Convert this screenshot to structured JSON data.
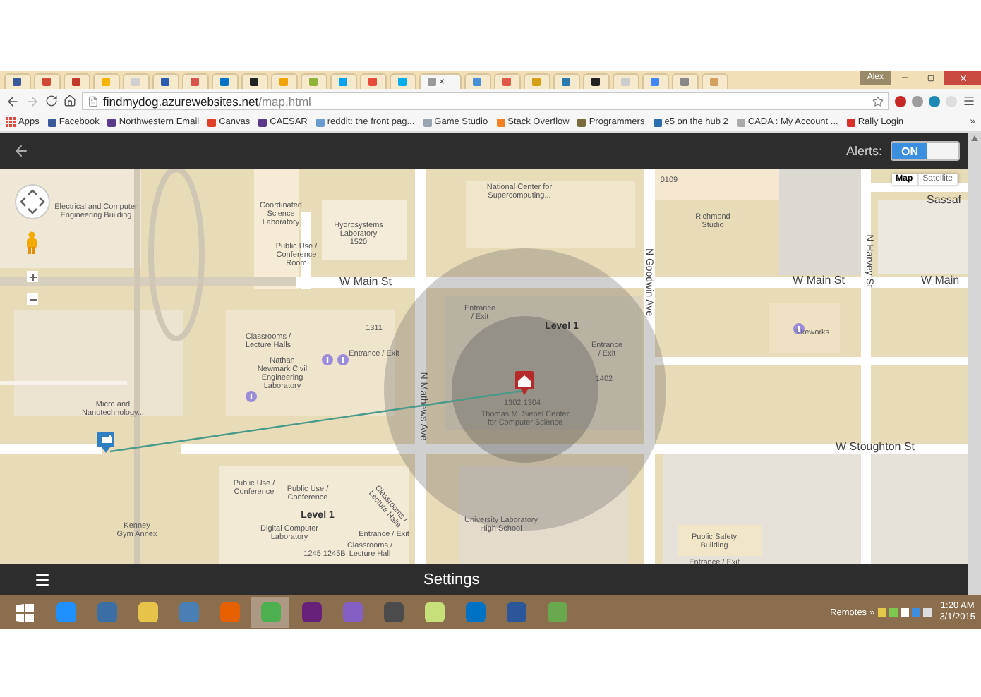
{
  "browser": {
    "tabs": [
      {
        "color": "#3b5998",
        "selected": false
      },
      {
        "color": "#d14836",
        "selected": false
      },
      {
        "color": "#c0392b",
        "selected": false
      },
      {
        "color": "#f4b400",
        "selected": false
      },
      {
        "color": "#cfcfcf",
        "selected": false
      },
      {
        "color": "#2a5db0",
        "selected": false
      },
      {
        "color": "#d9534f",
        "selected": false
      },
      {
        "color": "#0072c6",
        "selected": false
      },
      {
        "color": "#222222",
        "selected": false
      },
      {
        "color": "#f0a30a",
        "selected": false
      },
      {
        "color": "#8fb339",
        "selected": false
      },
      {
        "color": "#00a1f1",
        "selected": false
      },
      {
        "color": "#e74c3c",
        "selected": false
      },
      {
        "color": "#00adef",
        "selected": false
      },
      {
        "color": "#999999",
        "selected": true
      },
      {
        "color": "#4a90d9",
        "selected": false
      },
      {
        "color": "#e05a47",
        "selected": false
      },
      {
        "color": "#d4a017",
        "selected": false
      },
      {
        "color": "#2a7ab0",
        "selected": false
      },
      {
        "color": "#222222",
        "selected": false
      },
      {
        "color": "#cccccc",
        "selected": false
      },
      {
        "color": "#4285f4",
        "selected": false
      },
      {
        "color": "#888888",
        "selected": false
      },
      {
        "color": "#d4a060",
        "selected": false
      }
    ],
    "tab_close": "×",
    "profile": "Alex",
    "address": {
      "domain": "findmydog.azurewebsites.net",
      "path": "/map.html"
    },
    "bookmarks": [
      {
        "label": "Apps",
        "color": "#e04a3a"
      },
      {
        "label": "Facebook",
        "color": "#3b5998"
      },
      {
        "label": "Northwestern Email",
        "color": "#5b3a8c"
      },
      {
        "label": "Canvas",
        "color": "#e13f2b"
      },
      {
        "label": "CAESAR",
        "color": "#5b3a8c"
      },
      {
        "label": "reddit: the front pag...",
        "color": "#6b9bd1"
      },
      {
        "label": "Game Studio",
        "color": "#9aa3b0"
      },
      {
        "label": "Stack Overflow",
        "color": "#f48024"
      },
      {
        "label": "Programmers",
        "color": "#7a6a3a"
      },
      {
        "label": "e5 on the hub 2",
        "color": "#2a6db0"
      },
      {
        "label": "CADA : My Account ...",
        "color": "#aaaaaa"
      },
      {
        "label": "Rally Login",
        "color": "#d9302b"
      }
    ],
    "bookmarks_more": "»"
  },
  "app": {
    "alerts": {
      "label": "Alerts:",
      "toggle_text": "ON",
      "on": true
    }
  },
  "map": {
    "type_buttons": [
      {
        "label": "Map",
        "selected": true
      },
      {
        "label": "Satellite",
        "selected": false
      }
    ],
    "labels": [
      {
        "kind": "building",
        "lines": [
          "Electrical and Computer",
          "Engineering Building"
        ]
      },
      {
        "kind": "building",
        "lines": [
          "Coordinated",
          "Science",
          "Laboratory"
        ]
      },
      {
        "kind": "building",
        "lines": [
          "Hydrosystems",
          "Laboratory",
          "1520"
        ]
      },
      {
        "kind": "building",
        "lines": [
          "Public Use /",
          "Conference",
          "Room"
        ]
      },
      {
        "kind": "building",
        "lines": [
          "National Center for",
          "Supercomputing..."
        ]
      },
      {
        "kind": "building",
        "lines": [
          "0109"
        ]
      },
      {
        "kind": "building",
        "lines": [
          "Richmond",
          "Studio"
        ]
      },
      {
        "kind": "street",
        "lines": [
          "W Main St"
        ]
      },
      {
        "kind": "street",
        "lines": [
          "W Main St"
        ]
      },
      {
        "kind": "street",
        "lines": [
          "W Main"
        ]
      },
      {
        "kind": "avenue",
        "lines": [
          "N Goodwin Ave"
        ]
      },
      {
        "kind": "avenue",
        "lines": [
          "N Harvey St"
        ]
      },
      {
        "kind": "building",
        "lines": [
          "Bikeworks"
        ]
      },
      {
        "kind": "building",
        "lines": [
          "Classrooms /",
          "Lecture Halls"
        ]
      },
      {
        "kind": "building",
        "lines": [
          "Nathan",
          "Newmark Civil",
          "Engineering",
          "Laboratory"
        ]
      },
      {
        "kind": "building",
        "lines": [
          "1311"
        ]
      },
      {
        "kind": "building",
        "lines": [
          "Entrance / Exit"
        ]
      },
      {
        "kind": "building",
        "lines": [
          "Entrance",
          "/ Exit"
        ]
      },
      {
        "kind": "building",
        "lines": [
          "Entrance",
          "/ Exit"
        ]
      },
      {
        "kind": "level",
        "lines": [
          "Level 1"
        ]
      },
      {
        "kind": "building",
        "lines": [
          "1402"
        ]
      },
      {
        "kind": "avenue",
        "lines": [
          "N Mathews Ave"
        ]
      },
      {
        "kind": "building",
        "lines": [
          "Micro and",
          "Nanotechnology..."
        ]
      },
      {
        "kind": "building",
        "lines": [
          "1302 1304"
        ]
      },
      {
        "kind": "building",
        "lines": [
          "Thomas M. Siebel Center",
          "for Computer Science"
        ]
      },
      {
        "kind": "street",
        "lines": [
          "W Stoughton St"
        ]
      },
      {
        "kind": "building",
        "lines": [
          "Public Use /",
          "Conference"
        ]
      },
      {
        "kind": "building",
        "lines": [
          "Public Use /",
          "Conference"
        ]
      },
      {
        "kind": "level",
        "lines": [
          "Level 1"
        ]
      },
      {
        "kind": "building",
        "lines": [
          "Digital Computer",
          "Laboratory"
        ]
      },
      {
        "kind": "building",
        "lines": [
          "Classrooms /",
          "Lecture Halls"
        ]
      },
      {
        "kind": "building",
        "lines": [
          "Entrance / Exit"
        ]
      },
      {
        "kind": "building",
        "lines": [
          "University Laboratory",
          "High School"
        ]
      },
      {
        "kind": "building",
        "lines": [
          "Kenney",
          "Gym Annex"
        ]
      },
      {
        "kind": "building",
        "lines": [
          "Public Safety",
          "Building"
        ]
      },
      {
        "kind": "building",
        "lines": [
          "Entrance / Exit"
        ]
      },
      {
        "kind": "building",
        "lines": [
          "1245 1245B"
        ]
      },
      {
        "kind": "building",
        "lines": [
          "Classrooms /",
          "Lecture Hall"
        ]
      },
      {
        "kind": "street",
        "lines": [
          "Sassaf"
        ]
      }
    ]
  },
  "settings_bar": {
    "title": "Settings"
  },
  "taskbar": {
    "apps": [
      {
        "color": "#1e90ff",
        "selected": false
      },
      {
        "color": "#3a6ea5",
        "selected": false
      },
      {
        "color": "#e8c34a",
        "selected": false
      },
      {
        "color": "#4a7fb5",
        "selected": false
      },
      {
        "color": "#e66000",
        "selected": false
      },
      {
        "color": "#4caf50",
        "selected": true
      },
      {
        "color": "#68217a",
        "selected": false
      },
      {
        "color": "#865fc5",
        "selected": false
      },
      {
        "color": "#4b4b4b",
        "selected": false
      },
      {
        "color": "#c8e07a",
        "selected": false
      },
      {
        "color": "#0072c6",
        "selected": false
      },
      {
        "color": "#2b579a",
        "selected": false
      },
      {
        "color": "#6aa84f",
        "selected": false
      }
    ],
    "toolbar_label": "Remotes",
    "more": "»",
    "time": "1:20 AM",
    "date": "3/1/2015"
  }
}
